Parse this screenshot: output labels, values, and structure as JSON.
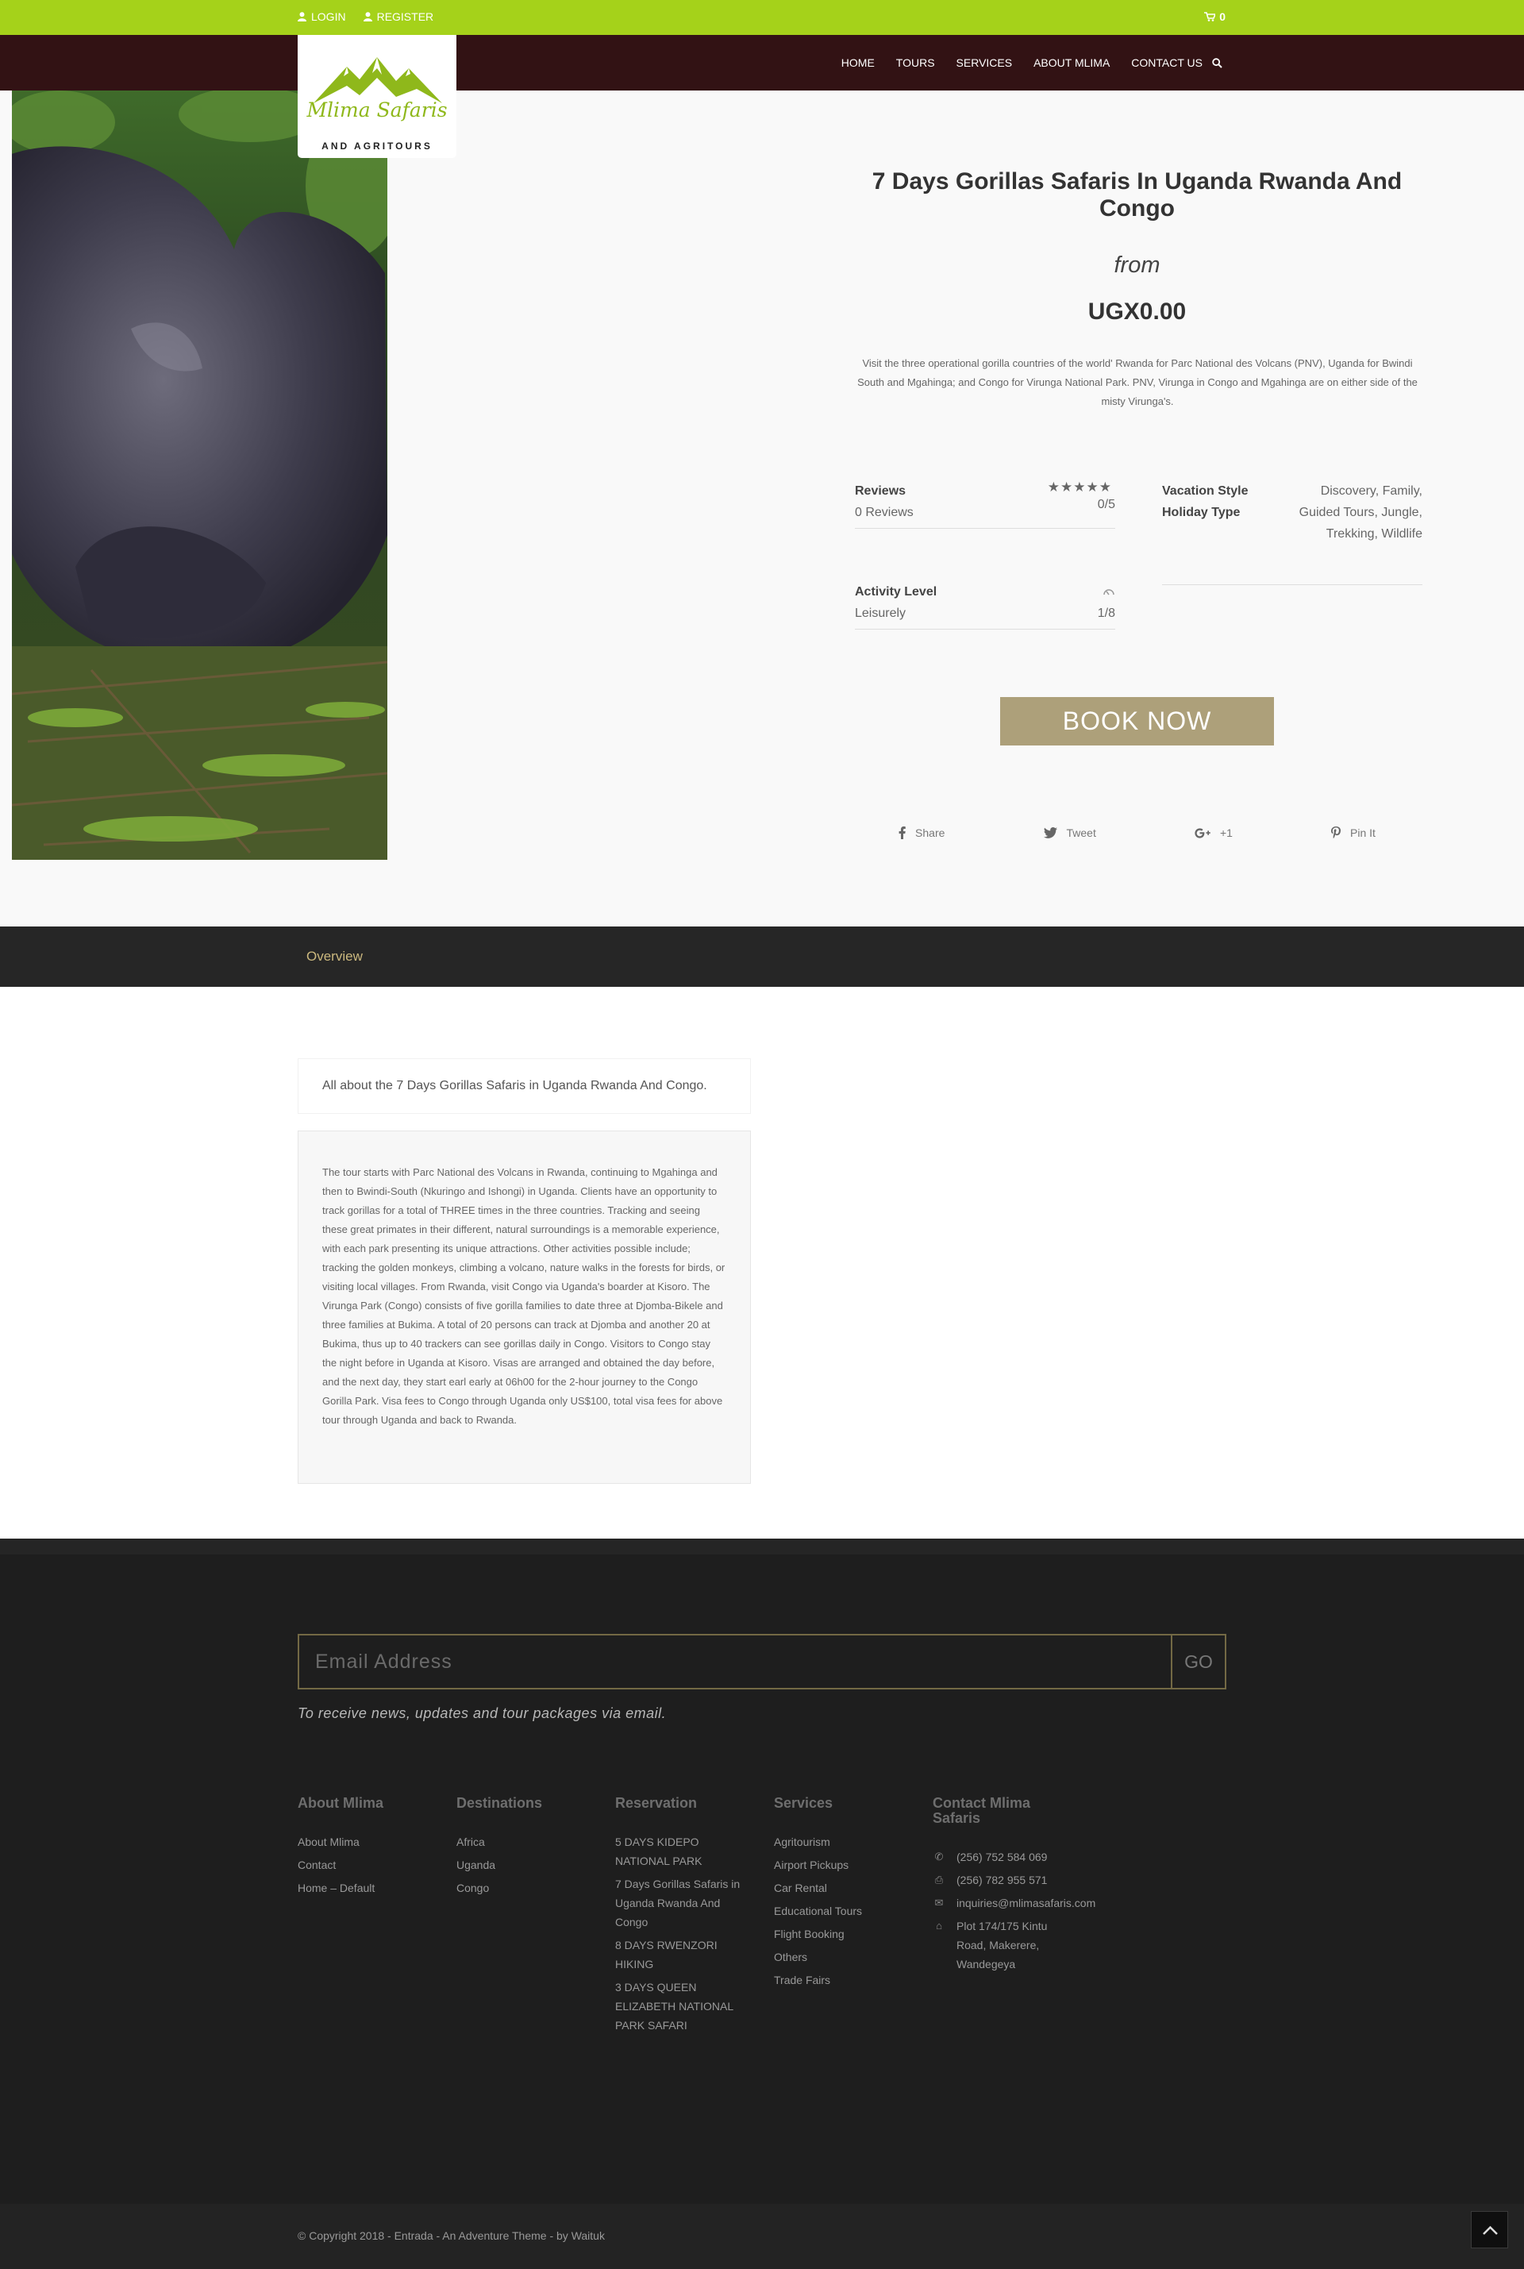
{
  "topbar": {
    "login": "LOGIN",
    "register": "REGISTER",
    "cart_count": "0",
    "bg_color": "#a5d21a"
  },
  "logo": {
    "script": "Mlima Safaris",
    "sub": "AND AGRITOURS"
  },
  "nav": {
    "items": [
      "HOME",
      "TOURS",
      "SERVICES",
      "ABOUT MLIMA",
      "CONTACT US"
    ],
    "bg_color": "#321214"
  },
  "tour": {
    "title": "7 Days Gorillas Safaris In Uganda Rwanda And Congo",
    "from_label": "from",
    "price": "UGX0.00",
    "description": "Visit the three operational gorilla countries of the world' Rwanda for Parc National des Volcans (PNV), Uganda for Bwindi South and Mgahinga; and Congo for Virunga National Park. PNV, Virunga in Congo and Mgahinga are on either side of the misty Virunga's.",
    "reviews_label": "Reviews",
    "reviews_count": "0 Reviews",
    "rating": "0/5",
    "vacation_style_label": "Vacation Style",
    "vacation_style_value": "Discovery, Family,",
    "holiday_type_label": "Holiday Type",
    "holiday_type_value_1": "Guided Tours, Jungle,",
    "holiday_type_value_2": "Trekking, Wildlife",
    "activity_label": "Activity Level",
    "activity_value": "Leisurely",
    "activity_score": "1/8",
    "book_now": "BOOK NOW",
    "accent_color": "#ada07a"
  },
  "share": {
    "facebook": "Share",
    "twitter": "Tweet",
    "gplus": "+1",
    "pinterest": "Pin It"
  },
  "tabs": {
    "overview": "Overview"
  },
  "overview": {
    "heading": "All about the 7 Days Gorillas Safaris in Uganda Rwanda And Congo.",
    "body": "The tour starts with Parc National des Volcans in Rwanda, continuing to Mgahinga and then to Bwindi-South (Nkuringo and Ishongi) in Uganda. Clients have an opportunity to track gorillas for a total of THREE times in the three countries. Tracking and seeing these great primates in their different, natural surroundings is a memorable experience, with each park presenting its unique attractions. Other activities possible include; tracking the golden monkeys, climbing a volcano, nature walks in the forests for birds, or visiting local villages. From Rwanda, visit Congo via Uganda's boarder at Kisoro. The Virunga Park (Congo) consists of five gorilla families to date three at Djomba-Bikele and three families at Bukima. A total of 20 persons can track at Djomba and another 20 at Bukima, thus up to 40 trackers can see gorillas daily in Congo. Visitors to Congo stay the night before in Uganda at Kisoro. Visas are arranged and obtained the day before, and the next day, they start earl early at 06h00 for the 2-hour journey to the Congo Gorilla Park. Visa fees to Congo through Uganda only US$100, total visa fees for above tour through Uganda and back to Rwanda."
  },
  "newsletter": {
    "placeholder": "Email Address",
    "go": "GO",
    "note": "To receive news, updates and tour packages via email."
  },
  "footer": {
    "about": {
      "title": "About Mlima",
      "items": [
        "About Mlima",
        "Contact",
        "Home – Default"
      ]
    },
    "destinations": {
      "title": "Destinations",
      "items": [
        "Africa",
        "Uganda",
        "Congo"
      ]
    },
    "reservation": {
      "title": "Reservation",
      "items": [
        "5 DAYS KIDEPO NATIONAL PARK",
        "7 Days Gorillas Safaris in Uganda Rwanda And Congo",
        "8 DAYS RWENZORI HIKING",
        "3 DAYS QUEEN ELIZABETH NATIONAL PARK SAFARI"
      ]
    },
    "services": {
      "title": "Services",
      "items": [
        "Agritourism",
        "Airport Pickups",
        "Car Rental",
        "Educational Tours",
        "Flight Booking",
        "Others",
        "Trade Fairs"
      ]
    },
    "contact": {
      "title": "Contact Mlima Safaris",
      "phone": "(256) 752 584 069",
      "fax": "(256) 782 955 571",
      "email": "inquiries@mlimasafaris.com",
      "address": "Plot 174/175 Kintu Road, Makerere, Wandegeya"
    },
    "copyright": "© Copyright 2018 - Entrada - An Adventure Theme - by Waituk"
  }
}
